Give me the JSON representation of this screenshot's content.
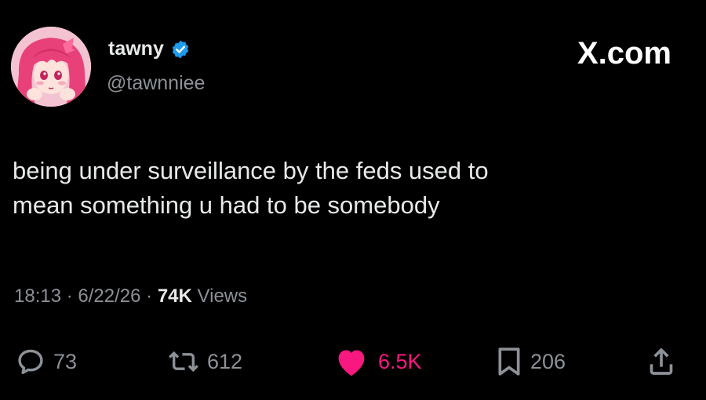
{
  "author": {
    "display_name": "tawny",
    "handle": "@tawnniee",
    "verified": true
  },
  "brand": "X.com",
  "tweet": {
    "lines": [
      "being under surveillance by the feds used to",
      "mean something u had to be somebody"
    ]
  },
  "meta": {
    "time": "18:13",
    "separator": "·",
    "date": "6/22/26",
    "views_count": "74K",
    "views_label": "Views"
  },
  "actions": {
    "replies": "73",
    "reposts": "612",
    "likes": "6.5K",
    "bookmarks": "206"
  },
  "icons": {
    "reply": "reply-icon",
    "repost": "repost-icon",
    "like": "heart-icon",
    "bookmark": "bookmark-icon",
    "share": "share-icon",
    "verified": "verified-badge-icon"
  },
  "colors": {
    "background": "#000000",
    "text_primary": "#e7e9ea",
    "text_secondary": "#8b9197",
    "verified_blue": "#1d9bf0",
    "like_pink": "#f91880"
  }
}
